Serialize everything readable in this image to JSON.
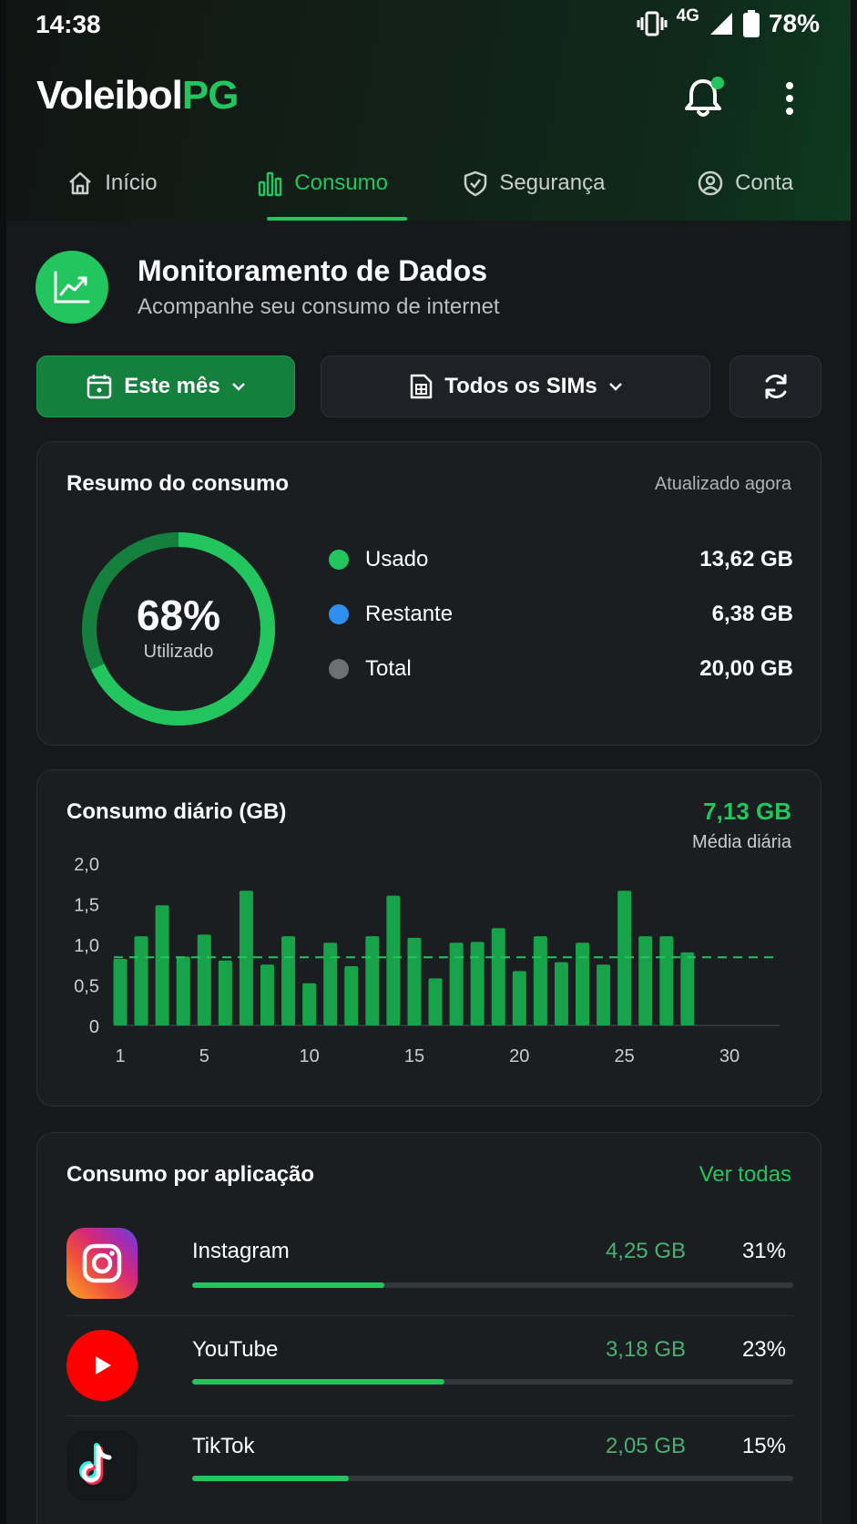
{
  "status": {
    "time": "14:38",
    "network": "4G",
    "battery": "78%"
  },
  "brand": {
    "part1": "Voleibol",
    "part2": "PG"
  },
  "tabs": [
    {
      "label": "Início",
      "icon": "home-icon",
      "active": false
    },
    {
      "label": "Consumo",
      "icon": "bar-chart-icon",
      "active": true
    },
    {
      "label": "Segurança",
      "icon": "shield-icon",
      "active": false
    },
    {
      "label": "Conta",
      "icon": "user-icon",
      "active": false
    }
  ],
  "header": {
    "title": "Monitoramento de Dados",
    "subtitle": "Acompanhe seu consumo de internet",
    "icon": "trend-chart-icon"
  },
  "filters": {
    "period": "Este mês",
    "sims": "Todos os SIMs"
  },
  "summary": {
    "title": "Resumo do consumo",
    "updated": "Atualizado agora",
    "percent": "68%",
    "percent_value": 0.68,
    "percent_label": "Utilizado",
    "legend": [
      {
        "name": "Usado",
        "value": "13,62 GB",
        "color": "#22c55e"
      },
      {
        "name": "Restante",
        "value": "6,38 GB",
        "color": "#2f8ff0"
      },
      {
        "name": "Total",
        "value": "20,00 GB",
        "color": "#6b7075"
      }
    ]
  },
  "chart_data": {
    "type": "bar",
    "title": "Consumo diário (GB)",
    "average_value": "7,13 GB",
    "average_label": "Média diária",
    "x": [
      1,
      2,
      3,
      4,
      5,
      6,
      7,
      8,
      9,
      10,
      11,
      12,
      13,
      14,
      15,
      16,
      17,
      18,
      19,
      20,
      21,
      22,
      23,
      24,
      25,
      26,
      27,
      28
    ],
    "values": [
      0.82,
      1.1,
      1.48,
      0.85,
      1.12,
      0.8,
      1.66,
      0.75,
      1.1,
      0.52,
      1.02,
      0.73,
      1.1,
      1.6,
      1.08,
      0.58,
      1.02,
      1.03,
      1.2,
      0.67,
      1.1,
      0.78,
      1.02,
      0.75,
      1.66,
      1.1,
      1.1,
      0.9
    ],
    "average_line": 0.84,
    "ylim": [
      0,
      2.0
    ],
    "xlim": [
      1,
      30
    ],
    "yticks": [
      "2,0",
      "1,5",
      "1,0",
      "0,5",
      "0"
    ],
    "xticks": [
      "1",
      "5",
      "10",
      "15",
      "20",
      "25",
      "30"
    ],
    "bar_color": "#16a34a",
    "grid": false
  },
  "apps": {
    "title": "Consumo por aplicação",
    "see_all": "Ver todas",
    "items": [
      {
        "name": "Instagram",
        "gb": "4,25 GB",
        "pct": "31%",
        "fraction": 0.32,
        "icon": "instagram-icon"
      },
      {
        "name": "YouTube",
        "gb": "3,18 GB",
        "pct": "23%",
        "fraction": 0.42,
        "icon": "youtube-icon"
      },
      {
        "name": "TikTok",
        "gb": "2,05 GB",
        "pct": "15%",
        "fraction": 0.26,
        "icon": "tiktok-icon"
      }
    ]
  }
}
